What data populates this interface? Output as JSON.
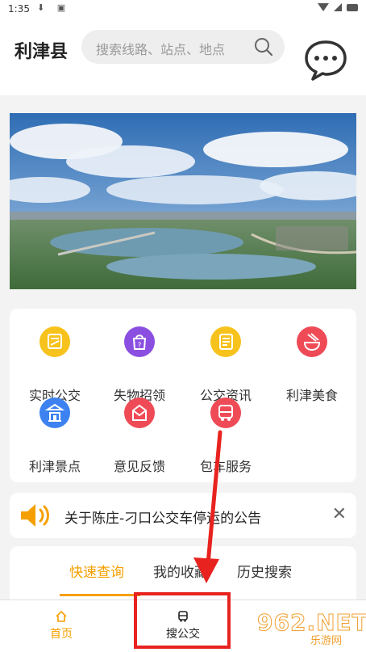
{
  "status_bar": {
    "time": "1:35"
  },
  "header": {
    "city": "利津县",
    "search_placeholder": "搜索线路、站点、地点"
  },
  "features": [
    {
      "label": "实时公交",
      "icon": "realtime-bus-icon",
      "color": "#f7c21b"
    },
    {
      "label": "失物招领",
      "icon": "lost-found-icon",
      "color": "#8a4fe0"
    },
    {
      "label": "公交资讯",
      "icon": "bus-news-icon",
      "color": "#f7c21b"
    },
    {
      "label": "利津美食",
      "icon": "food-icon",
      "color": "#ef4b57"
    },
    {
      "label": "利津景点",
      "icon": "scenic-spot-icon",
      "color": "#3d82f0"
    },
    {
      "label": "意见反馈",
      "icon": "feedback-icon",
      "color": "#ef4b57"
    },
    {
      "label": "包车服务",
      "icon": "charter-bus-icon",
      "color": "#ef4b57"
    }
  ],
  "notice": {
    "text": "关于陈庄-刁口公交车停运的公告",
    "close": "✕"
  },
  "tabs": [
    {
      "label": "快速查询",
      "active": true
    },
    {
      "label": "我的收藏",
      "active": false
    },
    {
      "label": "历史搜索",
      "active": false
    }
  ],
  "bottom_nav": [
    {
      "label": "首页",
      "icon": "home-icon",
      "active": true
    },
    {
      "label": "搜公交",
      "icon": "bus-icon",
      "active": false
    }
  ],
  "watermark": {
    "big": "962.NET",
    "small": "乐游网"
  },
  "colors": {
    "accent": "#f5a000",
    "annotation_red": "#e8231f"
  }
}
